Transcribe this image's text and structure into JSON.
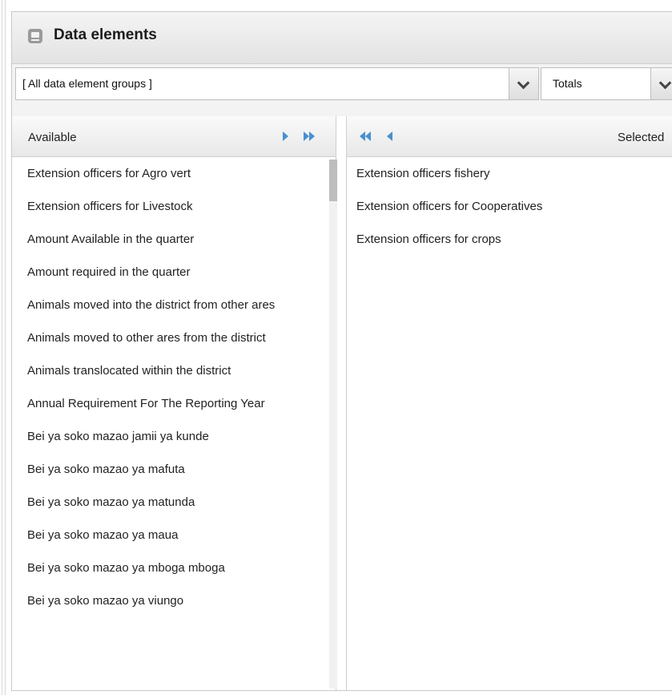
{
  "panel": {
    "title": "Data elements",
    "icon": "database-icon"
  },
  "group_select": {
    "value": "[ All data element groups ]"
  },
  "totals_select": {
    "value": "Totals"
  },
  "available": {
    "header": "Available",
    "items": [
      "Extension officers for Agro vert",
      "Extension officers for Livestock",
      "Amount Available in the quarter",
      "Amount required in the quarter",
      "Animals moved into the district from other ares",
      "Animals moved to other ares from the district",
      "Animals translocated within the district",
      "Annual Requirement For The Reporting Year",
      "Bei ya soko mazao jamii ya kunde",
      "Bei ya soko mazao ya mafuta",
      "Bei ya soko mazao ya matunda",
      "Bei ya soko mazao ya maua",
      "Bei ya soko mazao ya mboga mboga",
      "Bei ya soko mazao ya viungo"
    ]
  },
  "selected": {
    "header": "Selected",
    "items": [
      "Extension officers fishery",
      "Extension officers for Cooperatives",
      "Extension officers for crops"
    ]
  },
  "colors": {
    "accent": "#4a90d0"
  }
}
